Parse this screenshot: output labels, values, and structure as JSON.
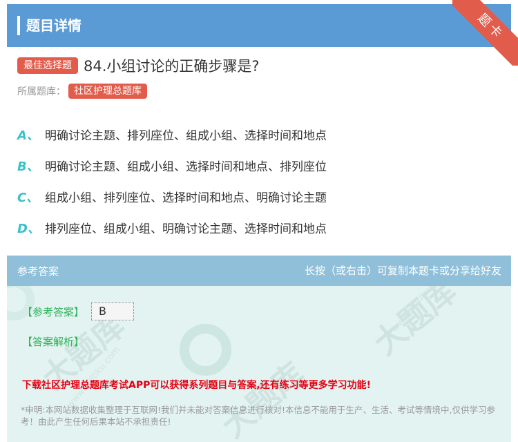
{
  "header": {
    "title": "题目详情"
  },
  "ribbon": {
    "label": "题卡"
  },
  "question": {
    "tag": "最佳选择题",
    "text": "84.小组讨论的正确步骤是?",
    "bank_label": "所属题库：",
    "bank_name": "社区护理总题库"
  },
  "options": [
    {
      "letter": "A、",
      "text": "明确讨论主题、排列座位、组成小组、选择时间和地点"
    },
    {
      "letter": "B、",
      "text": "明确讨论主题、组成小组、选择时间和地点、排列座位"
    },
    {
      "letter": "C、",
      "text": "组成小组、排列座位、选择时间和地点、明确讨论主题"
    },
    {
      "letter": "D、",
      "text": "排列座位、组成小组、明确讨论主题、选择时间和地点"
    }
  ],
  "answer_panel": {
    "title": "参考答案",
    "hint": "长按（或右击）可复制本题卡或分享给好友",
    "answer_label": "【参考答案】",
    "answer_value": "B",
    "analysis_label": "【答案解析】",
    "promo": "下载社区护理总题库考试APP可以获得系列题目与答案,还有练习等更多学习功能!",
    "disclaimer": "*申明:本网站数据收集整理于互联网!我们并未能对答案信息进行核对!本信息不能用于生产、生活、考试等情境中,仅供学习参考！由此产生任何后果本站不承担责任!",
    "watermark_text": "大题库",
    "watermark_url": "www.stdtiku.com"
  },
  "colors": {
    "header_bg": "#5b9bd5",
    "accent_red": "#e25c4b",
    "option_letter": "#3cc1c9",
    "answer_green": "#2fb35a",
    "promo_red": "#e60012"
  }
}
